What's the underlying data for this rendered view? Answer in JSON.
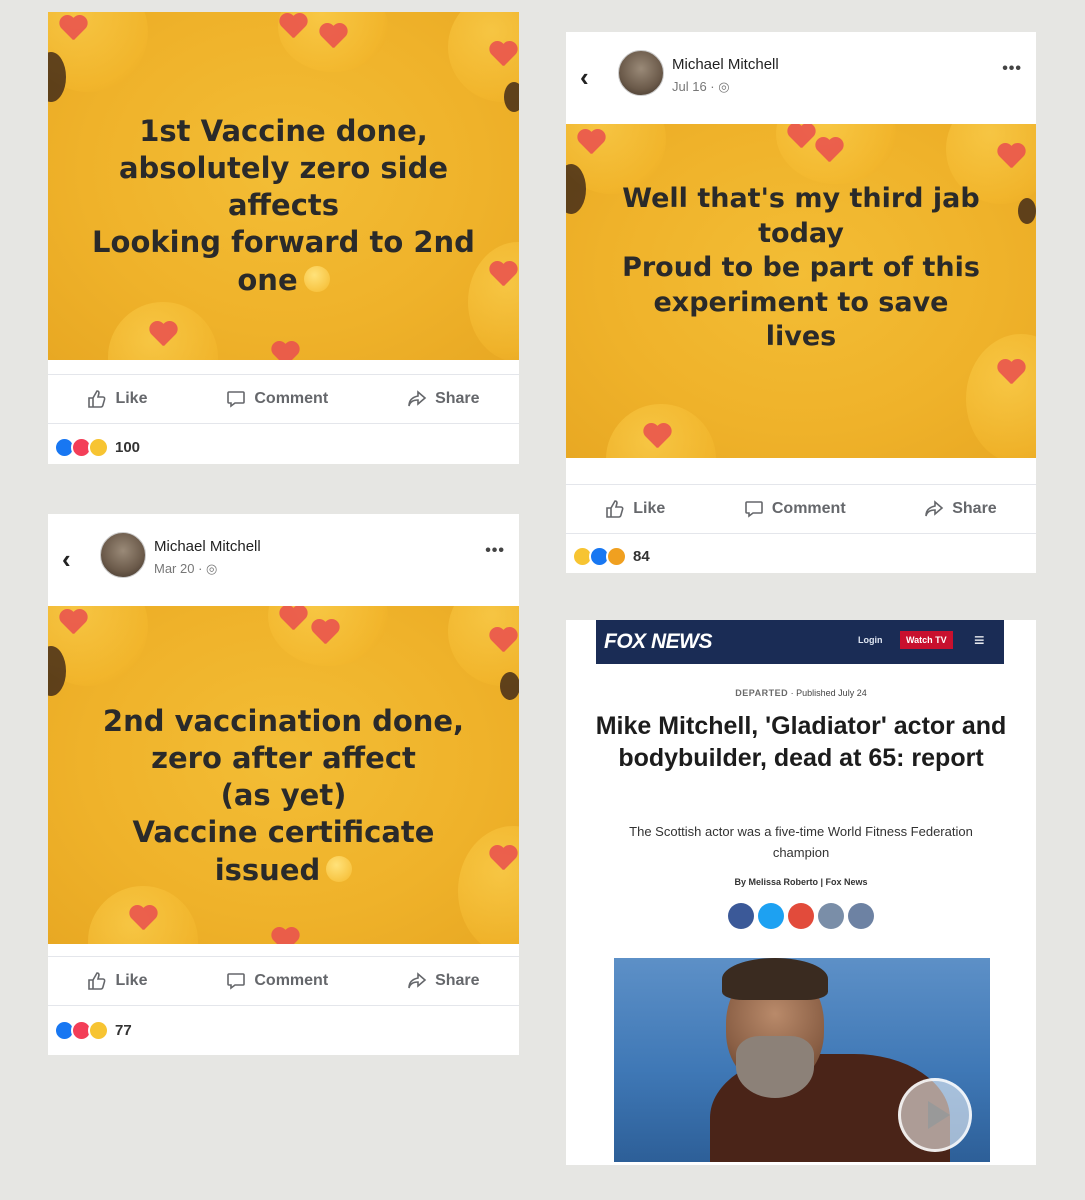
{
  "posts": [
    {
      "text": "1st Vaccine done,\nabsolutely zero side\naffects\nLooking forward to 2nd\none",
      "like": "Like",
      "comment": "Comment",
      "share": "Share",
      "reaction_count": "100"
    },
    {
      "author": "Michael Mitchell",
      "date": "Jul 16 · ",
      "text": "Well that's my third jab\ntoday\nProud to be part of this\nexperiment to save\nlives",
      "like": "Like",
      "comment": "Comment",
      "share": "Share",
      "reaction_count": "84"
    },
    {
      "author": "Michael Mitchell",
      "date": "Mar 20 · ",
      "text": "2nd vaccination done,\nzero after affect\n(as yet)\nVaccine certificate\nissued",
      "like": "Like",
      "comment": "Comment",
      "share": "Share",
      "reaction_count": "77"
    }
  ],
  "header_icons": {
    "back": "‹",
    "more": "•••"
  },
  "fox": {
    "logo": "FOX NEWS",
    "login": "Login",
    "watch": "Watch TV",
    "menu": "≡",
    "section": "DEPARTED",
    "published": "Published July 24",
    "headline": "Mike Mitchell, 'Gladiator' actor and bodybuilder, dead at 65: report",
    "subhead": "The Scottish actor was a five-time World Fitness Federation champion",
    "byline": "By Melissa Roberto | Fox News",
    "share_colors": [
      "#3b5998",
      "#1da1f2",
      "#e24b3b",
      "#7a8ea8",
      "#6d82a3"
    ]
  }
}
